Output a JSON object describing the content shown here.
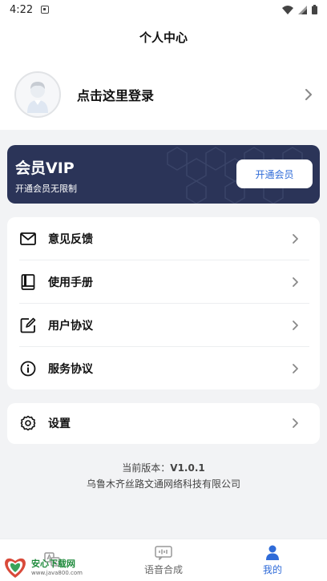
{
  "status_bar": {
    "time": "4:22"
  },
  "header": {
    "title": "个人中心"
  },
  "login": {
    "prompt": "点击这里登录"
  },
  "vip": {
    "title": "会员VIP",
    "subtitle": "开通会员无限制",
    "button_label": "开通会员"
  },
  "menu": {
    "items": [
      {
        "label": "意见反馈",
        "icon": "mail-icon"
      },
      {
        "label": "使用手册",
        "icon": "book-icon"
      },
      {
        "label": "用户协议",
        "icon": "edit-icon"
      },
      {
        "label": "服务协议",
        "icon": "info-icon"
      }
    ]
  },
  "settings": {
    "label": "设置",
    "icon": "gear-icon"
  },
  "footer": {
    "version_label": "当前版本：",
    "version_value": "V1.0.1",
    "company": "乌鲁木齐丝路文通网络科技有限公司"
  },
  "tabs": [
    {
      "label": "",
      "icon": "translate-icon"
    },
    {
      "label": "语音合成",
      "icon": "voice-icon"
    },
    {
      "label": "我的",
      "icon": "person-icon",
      "active": true
    }
  ],
  "watermark": {
    "brand": "安心下载网",
    "url": "www.java800.com"
  },
  "colors": {
    "accent": "#2f6bd8",
    "vip_bg": "#2b3458",
    "page_bg": "#f2f3f5"
  }
}
